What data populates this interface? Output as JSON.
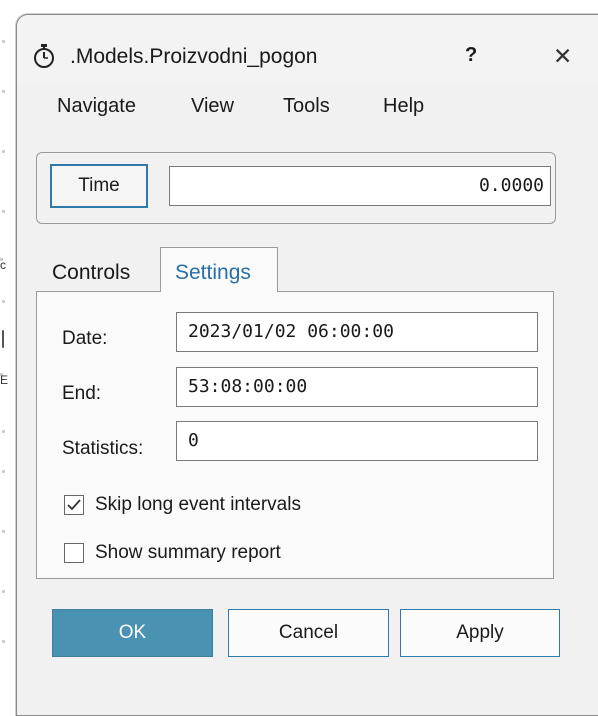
{
  "window": {
    "title": ".Models.Proizvodni_pogon",
    "help_label": "?",
    "close_label": "✕",
    "title_icon": "stopwatch-icon"
  },
  "menubar": {
    "items": [
      "Navigate",
      "View",
      "Tools",
      "Help"
    ]
  },
  "time": {
    "button_label": "Time",
    "value": "0.0000"
  },
  "tabs": {
    "items": [
      {
        "label": "Controls",
        "active": false
      },
      {
        "label": "Settings",
        "active": true
      }
    ]
  },
  "settings": {
    "date_label": "Date:",
    "date_value": "2023/01/02 06:00:00",
    "end_label": "End:",
    "end_value": "53:08:00:00",
    "statistics_label": "Statistics:",
    "statistics_value": "0",
    "skip_label": "Skip long event intervals",
    "skip_checked": true,
    "summary_label": "Show summary report",
    "summary_checked": false
  },
  "buttons": {
    "ok": "OK",
    "cancel": "Cancel",
    "apply": "Apply"
  },
  "background": {
    "marks": [
      "c",
      "E"
    ]
  },
  "colors": {
    "accent": "#2e7aa8",
    "ok_button": "#4a92b2",
    "active_tab_text": "#2a6ea8"
  }
}
